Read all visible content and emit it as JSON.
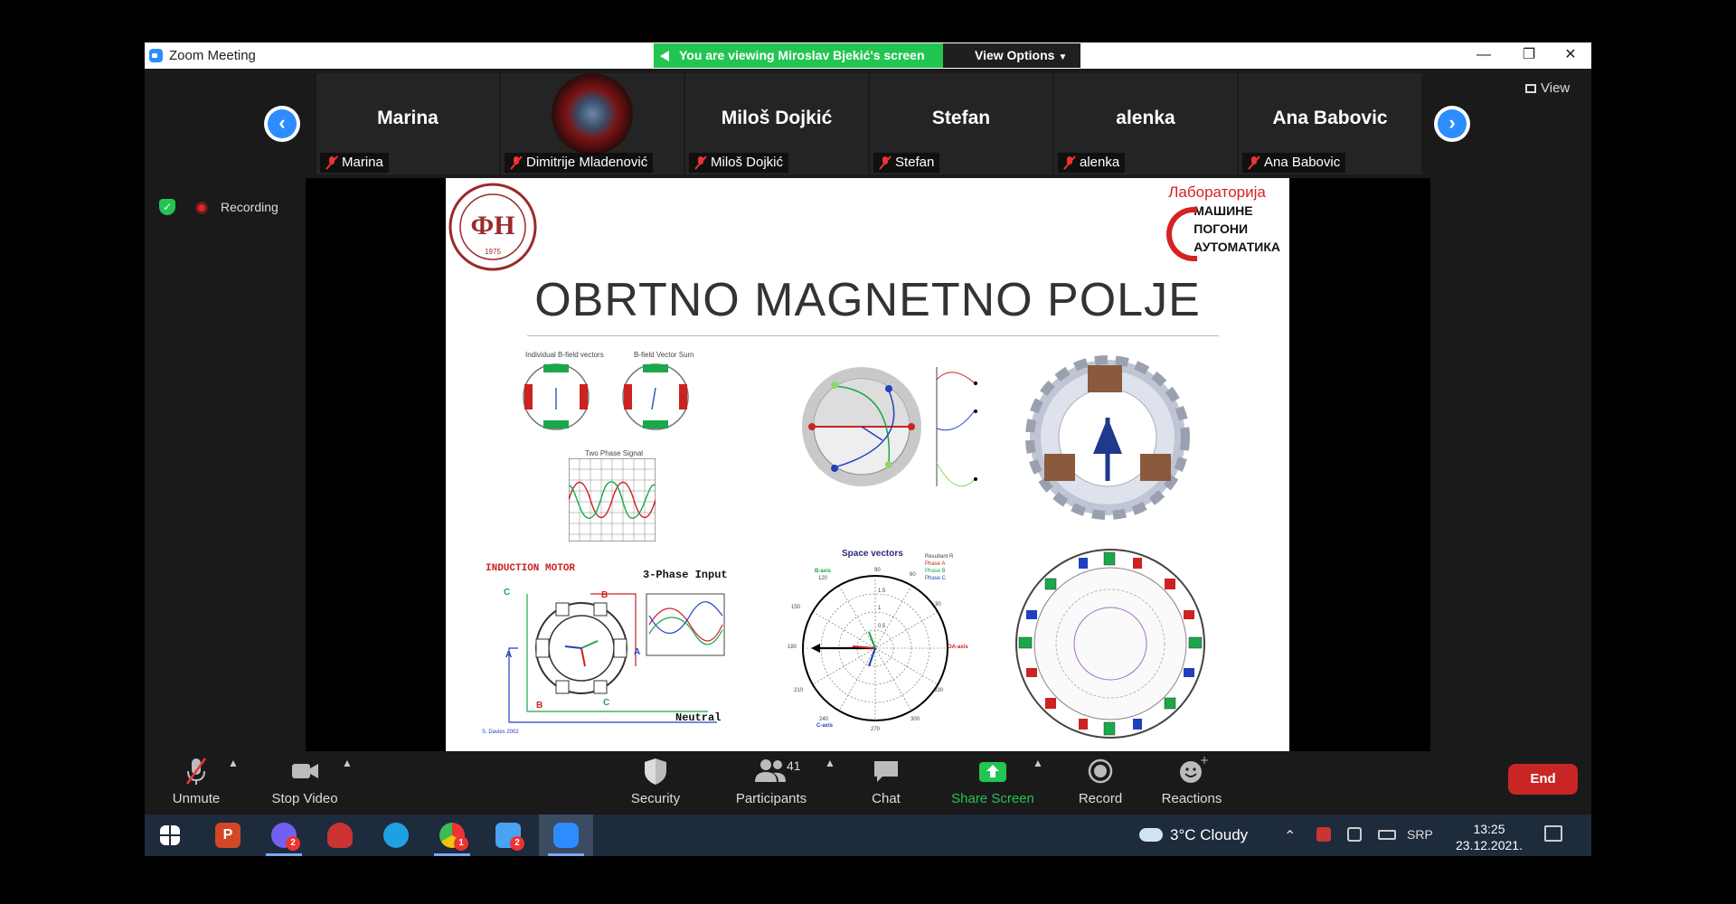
{
  "window": {
    "title": "Zoom Meeting"
  },
  "banner": {
    "viewing": "You are viewing Miroslav Bjekić's screen",
    "view_options": "View Options"
  },
  "gallery": {
    "participants": [
      {
        "big": "Marina",
        "label": "Marina"
      },
      {
        "big": "",
        "label": "Dimitrije Mladenović"
      },
      {
        "big": "Miloš Dojkić",
        "label": "Miloš Dojkić"
      },
      {
        "big": "Stefan",
        "label": "Stefan"
      },
      {
        "big": "alenka",
        "label": "alenka"
      },
      {
        "big": "Ana Babovic",
        "label": "Ana Babovic"
      }
    ],
    "view_label": "View"
  },
  "status": {
    "recording": "Recording"
  },
  "slide": {
    "title": "OBRTNO MAGNETNO POLJE",
    "logo_year": "1975",
    "lab": {
      "heading": "Лабораторија",
      "r1": "МАШИНЕ",
      "r2": "ПОГОНИ",
      "r3": "АУТОМАТИКА"
    },
    "captions": {
      "individual": "Individual B-field vectors",
      "sum": "B-field Vector Sum",
      "two_phase": "Two Phase Signal",
      "induction": "INDUCTION MOTOR",
      "three_phase": "3-Phase Input",
      "neutral": "Neutral",
      "author": "S. Davies 2002",
      "space_vectors": "Space vectors",
      "legend": [
        "Resultant R",
        "Phase A",
        "Phase B",
        "Phase C"
      ],
      "b_axis": "B-axis",
      "c_axis": "C-axis",
      "oa_axis": "OA-axis",
      "pA": "A",
      "pB": "B",
      "pC": "C",
      "ang90": "90",
      "ang60": "60",
      "ang120": "120",
      "ang30": "30",
      "ang150": "150",
      "ang180": "180",
      "ang210": "210",
      "ang330": "330",
      "ang240": "240",
      "ang300": "300",
      "ang270": "270",
      "r15": "1.5",
      "r1": "1",
      "r05": "0.5"
    }
  },
  "toolbar": {
    "unmute": "Unmute",
    "stop_video": "Stop Video",
    "security": "Security",
    "participants": "Participants",
    "participants_count": "41",
    "chat": "Chat",
    "share_screen": "Share Screen",
    "record": "Record",
    "reactions": "Reactions",
    "end": "End"
  },
  "taskbar": {
    "weather": "3°C  Cloudy",
    "lang": "SRP",
    "time": "13:25",
    "date": "23.12.2021.",
    "badges": {
      "viber": "2",
      "chrome": "1",
      "outlook": "2"
    }
  },
  "colors": {
    "zoom_blue": "#2d8cff",
    "green": "#23c552",
    "end_red": "#c92525"
  }
}
